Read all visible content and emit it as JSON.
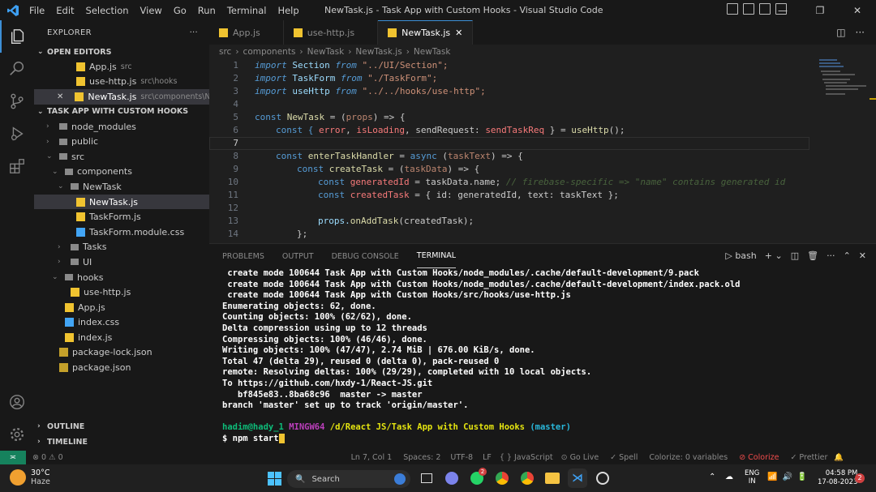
{
  "titlebar": {
    "menu": [
      "File",
      "Edit",
      "Selection",
      "View",
      "Go",
      "Run",
      "Terminal",
      "Help"
    ],
    "title": "NewTask.js - Task App with Custom Hooks - Visual Studio Code"
  },
  "explorer": {
    "header": "EXPLORER",
    "more": "···",
    "open_editors_label": "OPEN EDITORS",
    "open_editors": [
      {
        "name": "App.js",
        "path": "src"
      },
      {
        "name": "use-http.js",
        "path": "src\\hooks"
      },
      {
        "name": "NewTask.js",
        "path": "src\\components\\New..."
      }
    ],
    "workspace_label": "TASK APP WITH CUSTOM HOOKS",
    "tree": [
      {
        "name": "node_modules",
        "depth": 1,
        "type": "folder"
      },
      {
        "name": "public",
        "depth": 1,
        "type": "folder"
      },
      {
        "name": "src",
        "depth": 1,
        "type": "folder-open"
      },
      {
        "name": "components",
        "depth": 2,
        "type": "folder-open"
      },
      {
        "name": "NewTask",
        "depth": 3,
        "type": "folder-open"
      },
      {
        "name": "NewTask.js",
        "depth": 4,
        "type": "js",
        "active": true
      },
      {
        "name": "TaskForm.js",
        "depth": 4,
        "type": "js"
      },
      {
        "name": "TaskForm.module.css",
        "depth": 4,
        "type": "css"
      },
      {
        "name": "Tasks",
        "depth": 3,
        "type": "folder"
      },
      {
        "name": "UI",
        "depth": 3,
        "type": "folder"
      },
      {
        "name": "hooks",
        "depth": 2,
        "type": "folder-open"
      },
      {
        "name": "use-http.js",
        "depth": 3,
        "type": "js"
      },
      {
        "name": "App.js",
        "depth": 2,
        "type": "js"
      },
      {
        "name": "index.css",
        "depth": 2,
        "type": "css"
      },
      {
        "name": "index.js",
        "depth": 2,
        "type": "js"
      },
      {
        "name": "package-lock.json",
        "depth": 1,
        "type": "json"
      },
      {
        "name": "package.json",
        "depth": 1,
        "type": "json"
      }
    ],
    "outline_label": "OUTLINE",
    "timeline_label": "TIMELINE"
  },
  "tabs": [
    {
      "label": "App.js",
      "active": false
    },
    {
      "label": "use-http.js",
      "active": false
    },
    {
      "label": "NewTask.js",
      "active": true
    }
  ],
  "tab_close": "✕",
  "breadcrumbs": [
    "src",
    "components",
    "NewTask",
    "NewTask.js",
    "NewTask"
  ],
  "code": {
    "line_numbers": [
      "1",
      "2",
      "3",
      "4",
      "5",
      "6",
      "7",
      "8",
      "9",
      "10",
      "11",
      "12",
      "13",
      "14"
    ],
    "l1": [
      "import",
      " Section ",
      "from",
      " \"../UI/Section\";"
    ],
    "l2": [
      "import",
      " TaskForm ",
      "from",
      " \"./TaskForm\";"
    ],
    "l3": [
      "import",
      " useHttp ",
      "from",
      " \"../../hooks/use-http\";"
    ],
    "l5": [
      "const ",
      "NewTask",
      " = (",
      "props",
      ") => {"
    ],
    "l6": [
      "const { ",
      "error",
      ", ",
      "isLoading",
      ", sendRequest: ",
      "sendTaskReq",
      " } = ",
      "useHttp",
      "();"
    ],
    "l8": [
      "const ",
      "enterTaskHandler",
      " = ",
      "async",
      " (",
      "taskText",
      ") => {"
    ],
    "l9": [
      "const ",
      "createTask",
      " = (",
      "taskData",
      ") => {"
    ],
    "l10": [
      "const ",
      "generatedId",
      " = taskData.name; ",
      "// firebase-specific => \"name\" contains generated id"
    ],
    "l11": [
      "const ",
      "createdTask",
      " = { id: generatedId, text: taskText };"
    ],
    "l13": [
      "props.",
      "onAddTask",
      "(createdTask);"
    ],
    "l14": [
      "};"
    ]
  },
  "panel": {
    "tabs": [
      "PROBLEMS",
      "OUTPUT",
      "DEBUG CONSOLE",
      "TERMINAL"
    ],
    "active_tab": "TERMINAL",
    "shell": "bash"
  },
  "terminal": {
    "lines": [
      " create mode 100644 Task App with Custom Hooks/node_modules/.cache/default-development/9.pack",
      " create mode 100644 Task App with Custom Hooks/node_modules/.cache/default-development/index.pack.old",
      " create mode 100644 Task App with Custom Hooks/src/hooks/use-http.js",
      "Enumerating objects: 62, done.",
      "Counting objects: 100% (62/62), done.",
      "Delta compression using up to 12 threads",
      "Compressing objects: 100% (46/46), done.",
      "Writing objects: 100% (47/47), 2.74 MiB | 676.00 KiB/s, done.",
      "Total 47 (delta 29), reused 0 (delta 0), pack-reused 0",
      "remote: Resolving deltas: 100% (29/29), completed with 10 local objects.",
      "To https://github.com/hxdy-1/React-JS.git",
      "   bf845e83..8ba68c96  master -> master",
      "branch 'master' set up to track 'origin/master'."
    ],
    "prompt_user": "hadim@hady_1",
    "prompt_env": "MINGW64",
    "prompt_path": "/d/React JS/Task App with Custom Hooks",
    "prompt_branch": "(master)",
    "command": "$ npm start"
  },
  "statusbar": {
    "remote": "≍",
    "problems": "⊗ 0 ⚠ 0",
    "position": "Ln 7, Col 1",
    "spaces": "Spaces: 2",
    "encoding": "UTF-8",
    "eol": "LF",
    "language": "{ } JavaScript",
    "golive": "⊙ Go Live",
    "spell": "✓ Spell",
    "colorize_vars": "Colorize: 0 variables",
    "colorize": "⊘ Colorize",
    "prettier": "✓ Prettier"
  },
  "taskbar": {
    "weather_temp": "30°C",
    "weather_desc": "Haze",
    "search": "Search",
    "lang_top": "ENG",
    "lang_bottom": "IN",
    "time": "04:58 PM",
    "date": "17-08-2023",
    "notif": "2",
    "whatsapp_badge": "2"
  }
}
